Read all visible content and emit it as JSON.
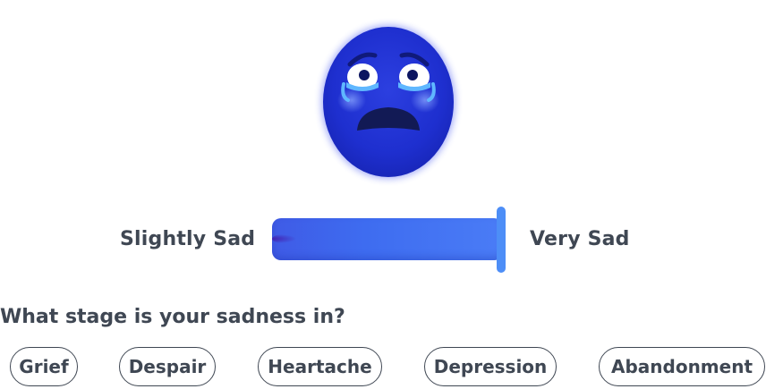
{
  "mood": {
    "icon": "crying-face-icon",
    "intensity": 1.0
  },
  "slider": {
    "min_label": "Slightly Sad",
    "max_label": "Very Sad"
  },
  "question": "What stage is your sadness in?",
  "stages": [
    "Grief",
    "Despair",
    "Heartache",
    "Depression",
    "Abandonment"
  ],
  "colors": {
    "face": "#2437d6",
    "face_glow": "#3a49e8",
    "track": "#3e6cf0",
    "thumb": "#4d8ef7",
    "text": "#3f4753"
  }
}
